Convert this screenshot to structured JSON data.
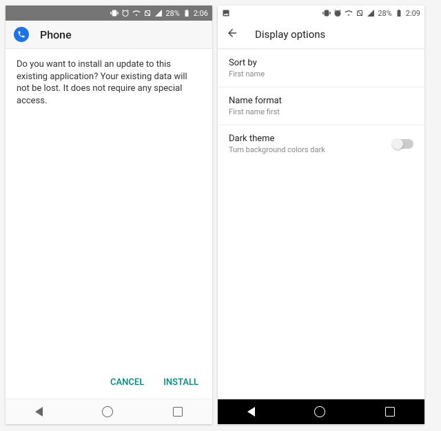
{
  "left": {
    "status": {
      "battery_pct": "28%",
      "time": "2:06"
    },
    "app_title": "Phone",
    "install_message": "Do you want to install an update to this existing application? Your existing data will not be lost. It does not require any special access.",
    "cancel_label": "CANCEL",
    "install_label": "INSTALL"
  },
  "right": {
    "status": {
      "battery_pct": "28%",
      "time": "2:09"
    },
    "screen_title": "Display options",
    "items": [
      {
        "title": "Sort by",
        "subtitle": "First name"
      },
      {
        "title": "Name format",
        "subtitle": "First name first"
      },
      {
        "title": "Dark theme",
        "subtitle": "Turn background colors dark",
        "toggle": false
      }
    ]
  }
}
